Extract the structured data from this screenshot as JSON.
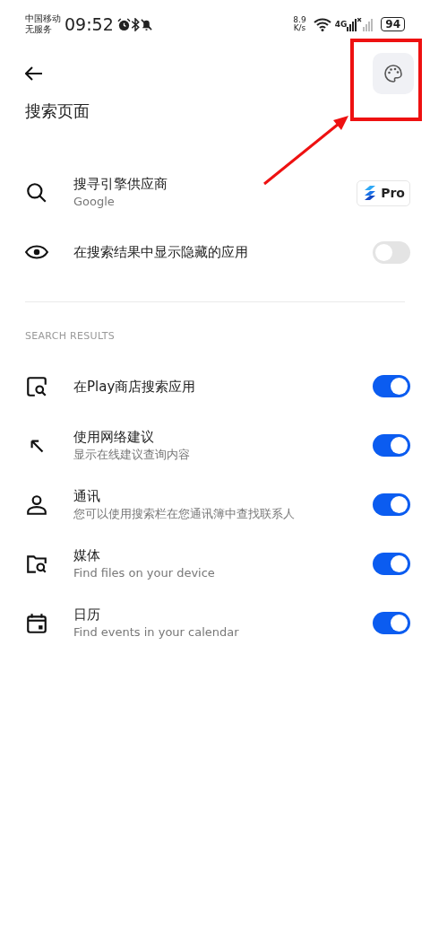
{
  "status_bar": {
    "carrier": "中国移动",
    "service": "无服务",
    "time": "09:52",
    "speed_value": "8.9",
    "speed_unit": "K/s",
    "network": "4G",
    "battery": "94"
  },
  "header": {
    "title": "搜索页面"
  },
  "top_settings": [
    {
      "kind": "provider",
      "label": "搜寻引擎供应商",
      "sublabel": "Google",
      "badge": "Pro"
    },
    {
      "kind": "toggle",
      "label": "在搜索结果中显示隐藏的应用",
      "on": false
    }
  ],
  "section": {
    "heading": "SEARCH RESULTS"
  },
  "result_settings": [
    {
      "kind": "toggle",
      "label": "在Play商店搜索应用",
      "on": true
    },
    {
      "kind": "toggle",
      "label": "使用网络建议",
      "sublabel": "显示在线建议查询内容",
      "on": true
    },
    {
      "kind": "toggle",
      "label": "通讯",
      "sublabel": "您可以使用搜索栏在您通讯簿中查找联系人",
      "on": true
    },
    {
      "kind": "toggle",
      "label": "媒体",
      "sublabel": "Find files on your device",
      "on": true
    },
    {
      "kind": "toggle",
      "label": "日历",
      "sublabel": "Find events in your calendar",
      "on": true
    }
  ],
  "annotation": {
    "highlight_box": true,
    "pointer_arrow": true
  }
}
